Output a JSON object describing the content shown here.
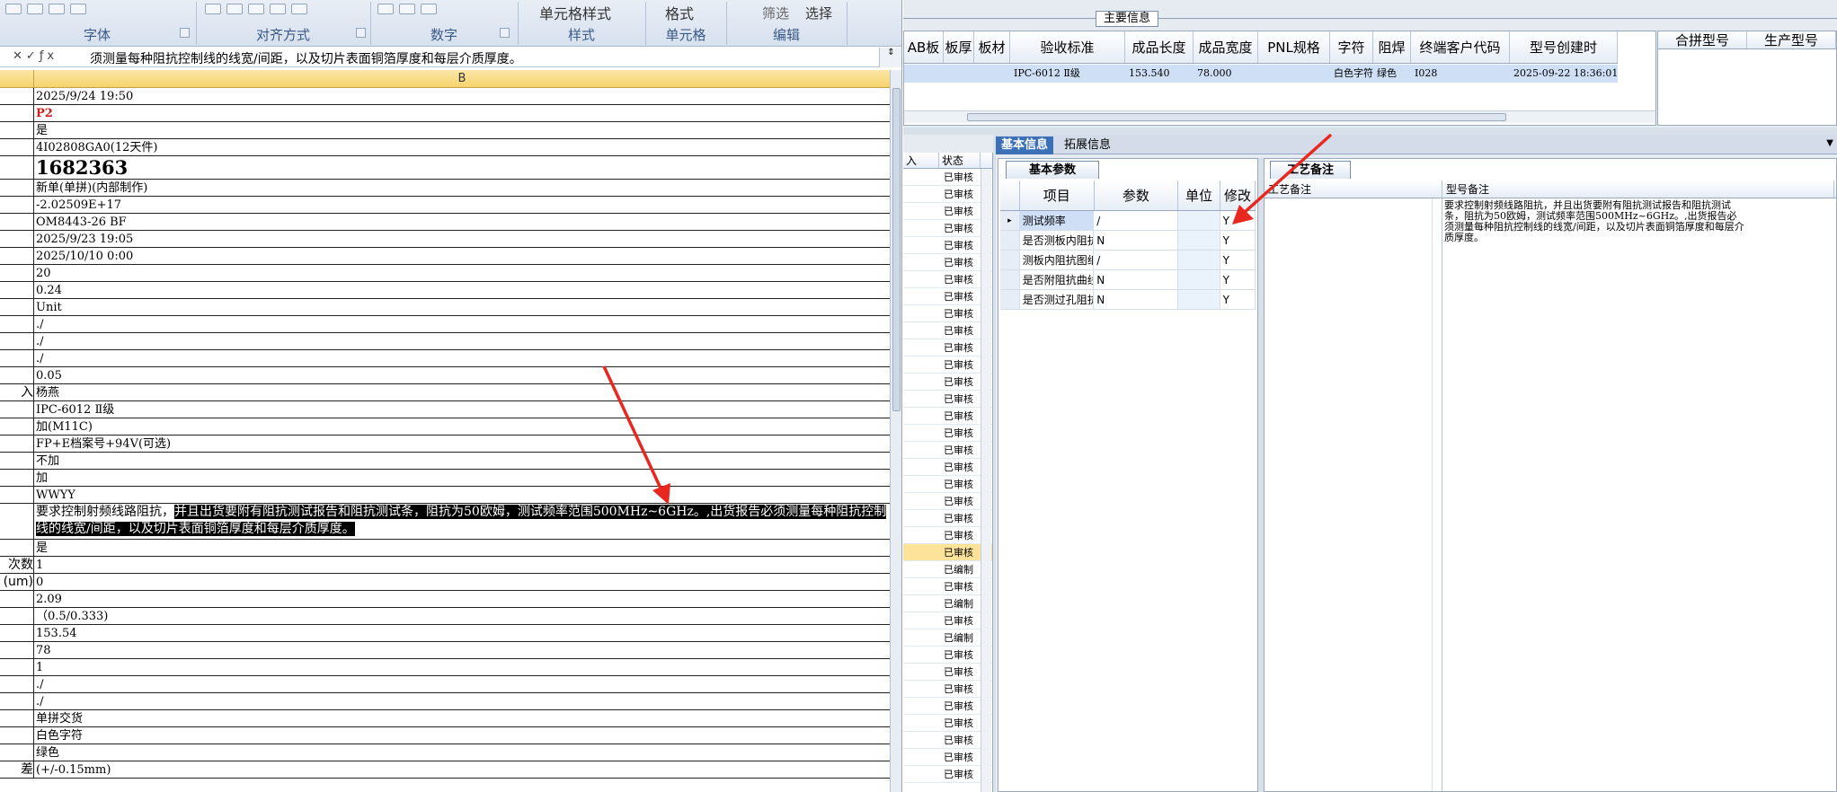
{
  "excel": {
    "ribbon_groups": [
      {
        "label": "字体"
      },
      {
        "label": "对齐方式"
      },
      {
        "label": "数字"
      },
      {
        "label": "样式"
      },
      {
        "label": "单元格"
      },
      {
        "label": "编辑"
      }
    ],
    "ribbon_buttons": {
      "cell_styles": "单元格样式",
      "format": "格式",
      "filter": "筛选",
      "select": "选择"
    },
    "formula_bar": {
      "content": "须测量每种阻抗控制线的线宽/间距，以及切片表面铜箔厚度和每层介质厚度。"
    },
    "column_b_label": "B",
    "rows": [
      {
        "a": "",
        "b": "2025/9/24 19:50"
      },
      {
        "a": "",
        "b": "P2",
        "style": "red"
      },
      {
        "a": "",
        "b": "是"
      },
      {
        "a": "",
        "b": "4I02808GA0(12天件)"
      },
      {
        "a": "",
        "b": "1682363",
        "style": "big"
      },
      {
        "a": "",
        "b": "新单(单拼)(内部制作)"
      },
      {
        "a": "",
        "b": "-2.02509E+17"
      },
      {
        "a": "",
        "b": "OM8443-26 BF"
      },
      {
        "a": "",
        "b": "2025/9/23 19:05"
      },
      {
        "a": "",
        "b": "2025/10/10 0:00"
      },
      {
        "a": "",
        "b": "20"
      },
      {
        "a": "",
        "b": "0.24"
      },
      {
        "a": "",
        "b": "Unit"
      },
      {
        "a": "",
        "b": "./"
      },
      {
        "a": "",
        "b": "./"
      },
      {
        "a": "",
        "b": "./"
      },
      {
        "a": "",
        "b": "0.05"
      },
      {
        "a": "入",
        "b": "杨燕"
      },
      {
        "a": "",
        "b": "IPC-6012 Ⅱ级"
      },
      {
        "a": "",
        "b": "加(M11C)"
      },
      {
        "a": "",
        "b": "FP+E档案号+94V(可选)"
      },
      {
        "a": "",
        "b": "不加"
      },
      {
        "a": "",
        "b": "加"
      },
      {
        "a": "",
        "b": "WWYY"
      },
      {
        "a": "",
        "b_pre": "要求控制射频线路阻抗，",
        "b_hl": "并且出货要附有阻抗测试报告和阻抗测试条，阻抗为50欧姆，测试频率范围500MHz~6GHz。,出货报告必须测量每种阻抗控制线的线宽/间距，以及切片表面铜箔厚度和每层介质厚度。",
        "style": "tall"
      },
      {
        "a": "",
        "b": "是"
      },
      {
        "a": "次数",
        "b": "1"
      },
      {
        "a": "(um)",
        "b": "0"
      },
      {
        "a": "",
        "b": "2.09"
      },
      {
        "a": "",
        "b": "（0.5/0.333)"
      },
      {
        "a": "",
        "b": "153.54"
      },
      {
        "a": "",
        "b": "78"
      },
      {
        "a": "",
        "b": "1"
      },
      {
        "a": "",
        "b": "./"
      },
      {
        "a": "",
        "b": "./"
      },
      {
        "a": "",
        "b": "单拼交货"
      },
      {
        "a": "",
        "b": "白色字符"
      },
      {
        "a": "",
        "b": "绿色"
      },
      {
        "a": "差",
        "b": "(+/-0.15mm)"
      }
    ]
  },
  "erp": {
    "main_info_label": "主要信息",
    "top_grid": {
      "columns": [
        "AB板",
        "板厚",
        "板材",
        "验收标准",
        "成品长度",
        "成品宽度",
        "PNL规格",
        "字符",
        "阻焊",
        "终端客户代码",
        "型号创建时"
      ],
      "row": [
        "",
        "",
        "",
        "IPC-6012 Ⅱ级",
        "153.540",
        "78.000",
        "",
        "白色字符",
        "绿色",
        "I028",
        "2025-09-22 18:36:01"
      ]
    },
    "merge_grid": {
      "columns": [
        "合拼型号",
        "生产型号"
      ]
    },
    "status_list": {
      "header": [
        "入",
        "状态"
      ],
      "items": [
        "已审核",
        "已审核",
        "已审核",
        "已审核",
        "已审核",
        "已审核",
        "已审核",
        "已审核",
        "已审核",
        "已审核",
        "已审核",
        "已审核",
        "已审核",
        "已审核",
        "已审核",
        "已审核",
        "已审核",
        "已审核",
        "已审核",
        "已审核",
        "已审核",
        "已审核",
        "已审核",
        "已编制",
        "已审核",
        "已编制",
        "已审核",
        "已编制",
        "已审核",
        "已审核",
        "已审核",
        "已审核",
        "已审核",
        "已审核",
        "已审核",
        "已审核"
      ],
      "selected_index": 22
    },
    "info_tabs": {
      "basic": "基本信息",
      "extended": "拓展信息"
    },
    "params": {
      "tab": "基本参数",
      "columns": [
        "项目",
        "参数",
        "单位",
        "修改"
      ],
      "rows": [
        {
          "item": "测试频率",
          "param": "/",
          "unit": "",
          "mod": "Y",
          "selected": true
        },
        {
          "item": "是否测板内阻抗",
          "param": "N",
          "unit": "",
          "mod": "Y"
        },
        {
          "item": "测板内阻抗图纸号",
          "param": "/",
          "unit": "",
          "mod": "Y"
        },
        {
          "item": "是否附阻抗曲线图",
          "param": "N",
          "unit": "",
          "mod": "Y"
        },
        {
          "item": "是否测过孔阻抗",
          "param": "N",
          "unit": "",
          "mod": "Y"
        }
      ]
    },
    "remarks": {
      "tab": "工艺备注",
      "columns": [
        "工艺备注",
        "型号备注"
      ],
      "model_remark": "要求控制射频线路阻抗，并且出货要附有阻抗测试报告和阻抗测试条，阻抗为50欧姆，测试频率范围500MHz~6GHz。,出货报告必须测量每种阻抗控制线的线宽/间距，以及切片表面铜箔厚度和每层介质厚度。"
    },
    "annotation_color": "#e8281f"
  }
}
